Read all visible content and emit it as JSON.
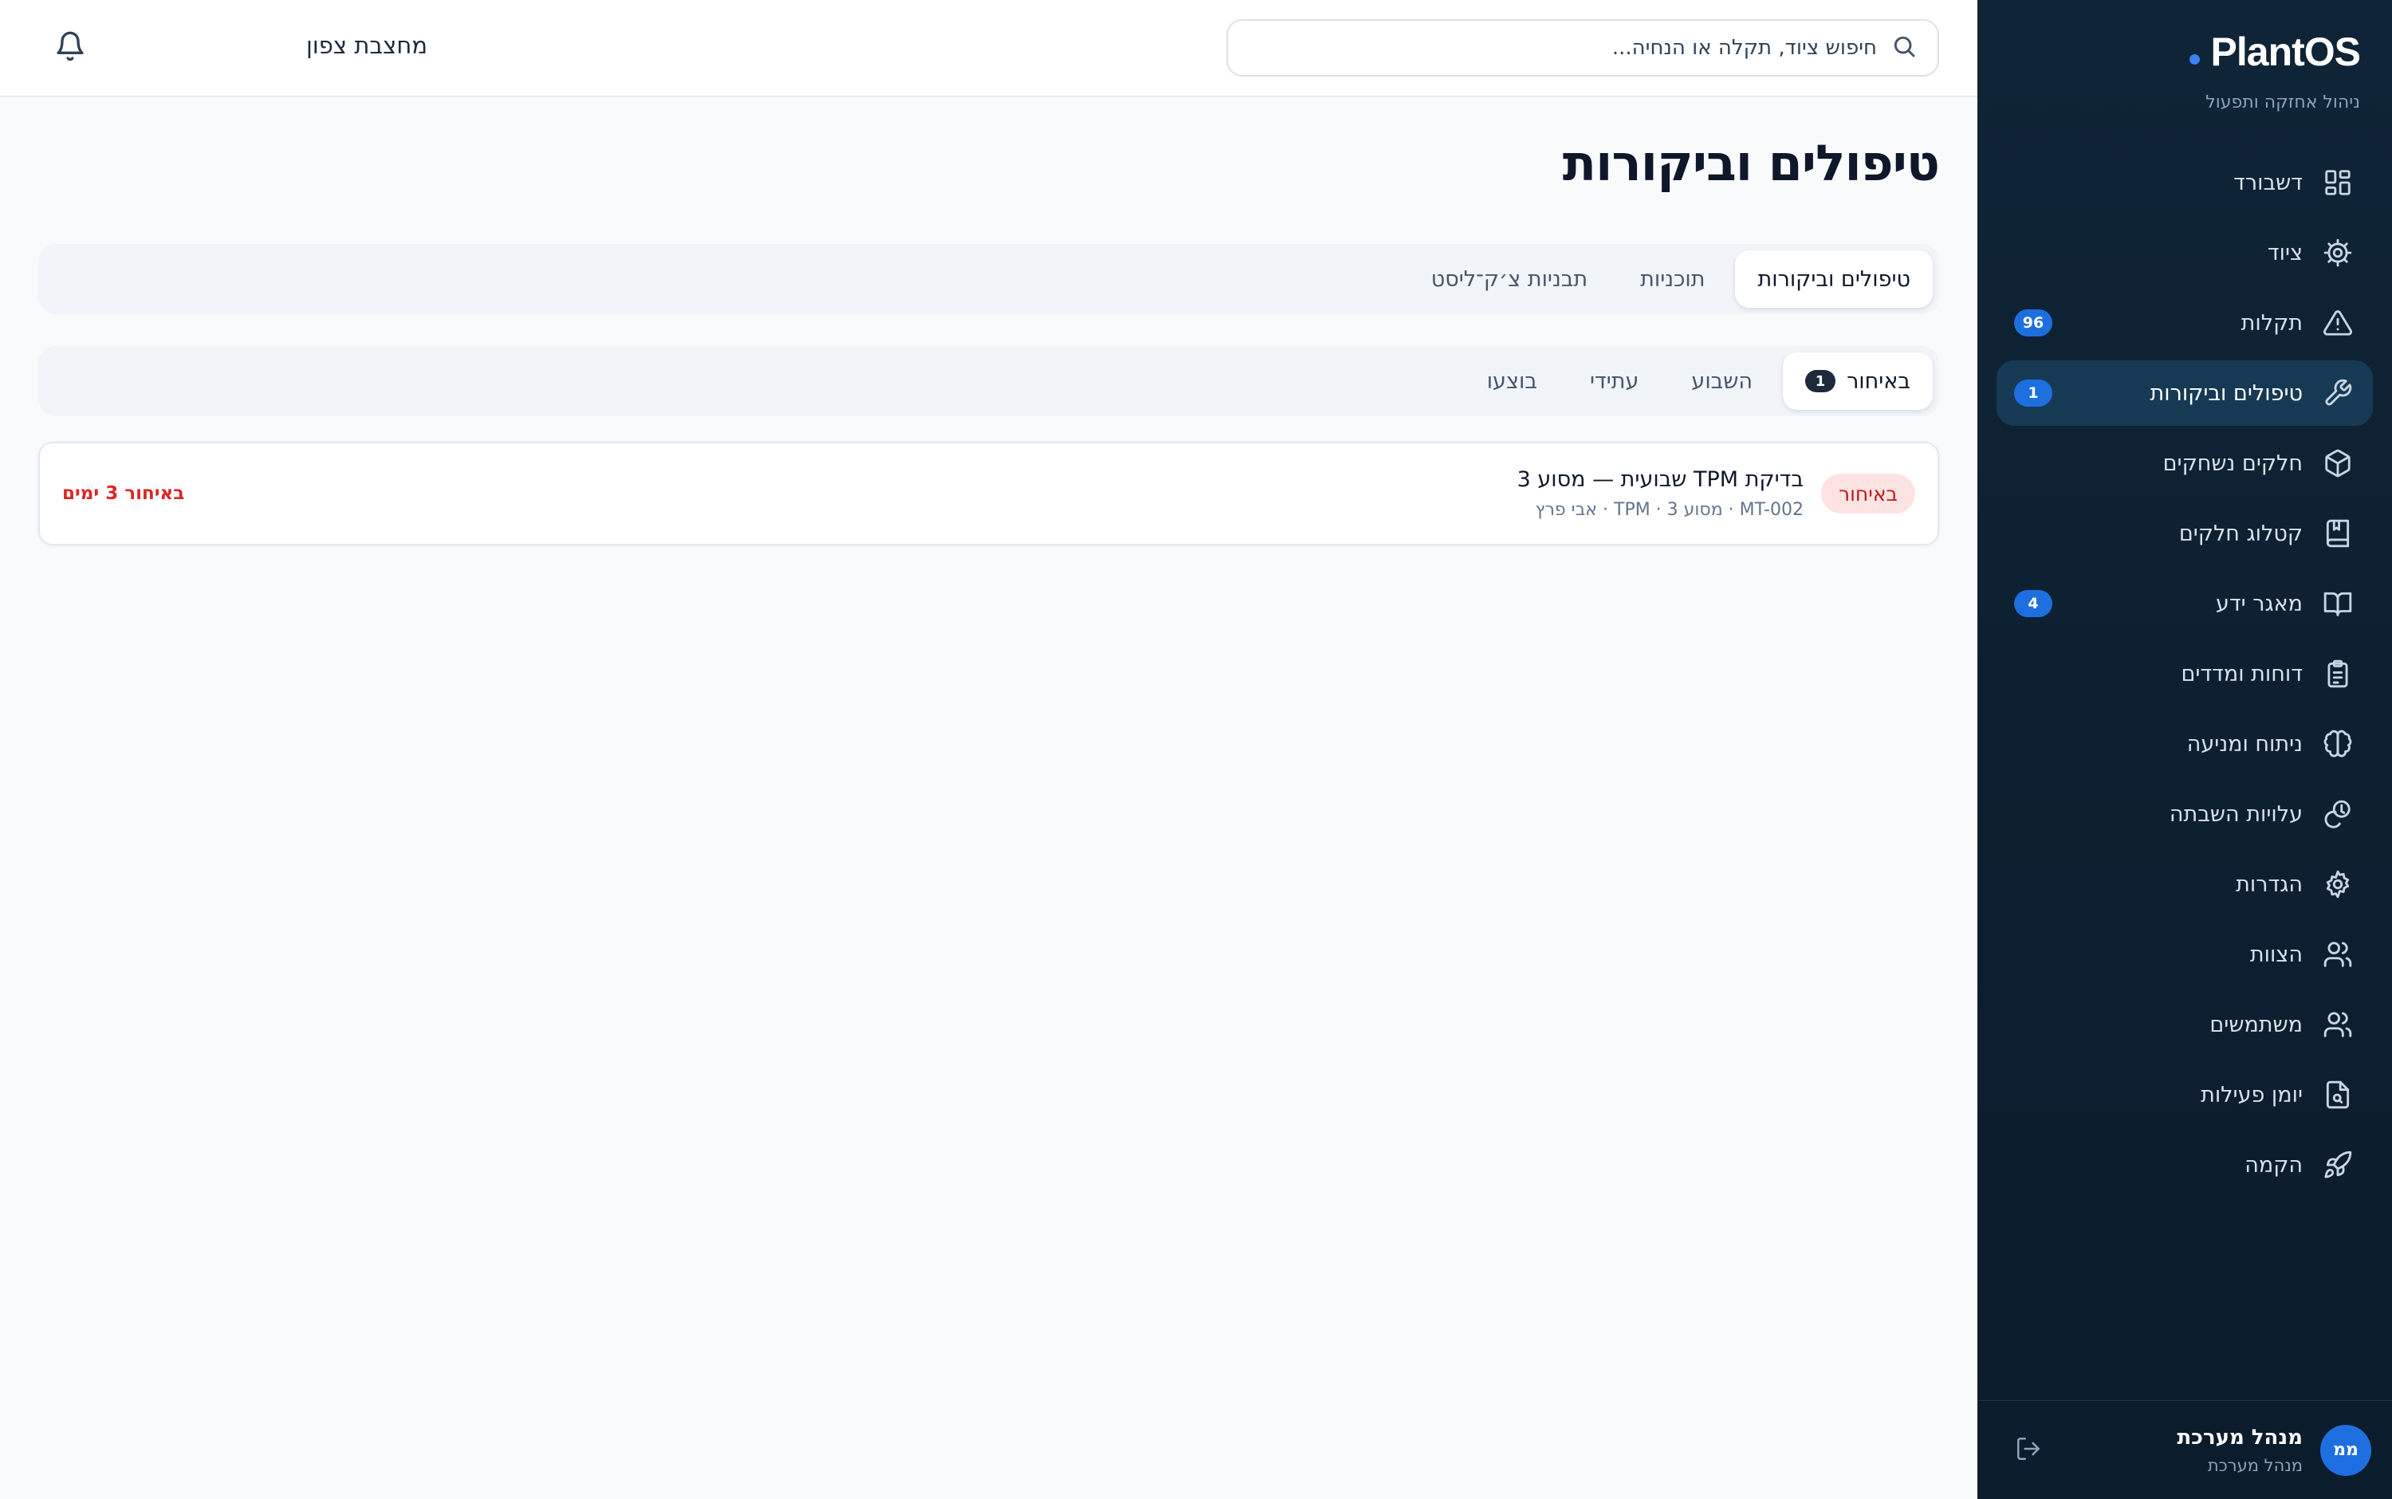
{
  "app": {
    "brand": "PlantOS",
    "subtitle": "ניהול אחזקה ותפעול"
  },
  "sidebar": {
    "items": [
      {
        "label": "דשבורד",
        "icon": "dashboard-icon",
        "badge": ""
      },
      {
        "label": "ציוד",
        "icon": "cog-icon",
        "badge": ""
      },
      {
        "label": "תקלות",
        "icon": "warning-triangle-icon",
        "badge": "96"
      },
      {
        "label": "טיפולים וביקורות",
        "icon": "wrench-icon",
        "badge": "1",
        "active": true
      },
      {
        "label": "חלקים נשחקים",
        "icon": "box-icon",
        "badge": ""
      },
      {
        "label": "קטלוג חלקים",
        "icon": "book-icon",
        "badge": ""
      },
      {
        "label": "מאגר ידע",
        "icon": "open-book-icon",
        "badge": "4"
      },
      {
        "label": "דוחות ומדדים",
        "icon": "clipboard-icon",
        "badge": ""
      },
      {
        "label": "ניתוח ומניעה",
        "icon": "brain-icon",
        "badge": ""
      },
      {
        "label": "עלויות השבתה",
        "icon": "coins-icon",
        "badge": ""
      },
      {
        "label": "הגדרות",
        "icon": "settings-icon",
        "badge": ""
      },
      {
        "label": "הצוות",
        "icon": "team-icon",
        "badge": ""
      },
      {
        "label": "משתמשים",
        "icon": "users-icon",
        "badge": ""
      },
      {
        "label": "יומן פעילות",
        "icon": "file-search-icon",
        "badge": ""
      },
      {
        "label": "הקמה",
        "icon": "rocket-icon",
        "badge": ""
      }
    ],
    "user": {
      "initials": "ממ",
      "name": "מנהל מערכת",
      "role": "מנהל מערכת"
    }
  },
  "topbar": {
    "search_placeholder": "חיפוש ציוד, תקלה או הנחיה...",
    "site_name": "מחצבת צפון"
  },
  "main": {
    "title": "טיפולים וביקורות",
    "tabs": [
      {
        "label": "טיפולים וביקורות",
        "active": true
      },
      {
        "label": "תוכניות",
        "active": false
      },
      {
        "label": "תבניות צ׳ק־ליסט",
        "active": false
      }
    ],
    "subtabs": [
      {
        "label": "באיחור",
        "count": "1",
        "active": true
      },
      {
        "label": "השבוע",
        "count": "",
        "active": false
      },
      {
        "label": "עתידי",
        "count": "",
        "active": false
      },
      {
        "label": "בוצעו",
        "count": "",
        "active": false
      }
    ],
    "items": [
      {
        "status": "באיחור",
        "title": "בדיקת TPM שבועית — מסוע 3",
        "meta": "MT-002 · מסוע 3 · TPM · אבי פרץ",
        "overdue": "באיחור 3 ימים"
      }
    ]
  },
  "colors": {
    "sidebar_bg": "#0f2436",
    "accent": "#1d6fe0",
    "overdue": "#dc2626"
  }
}
